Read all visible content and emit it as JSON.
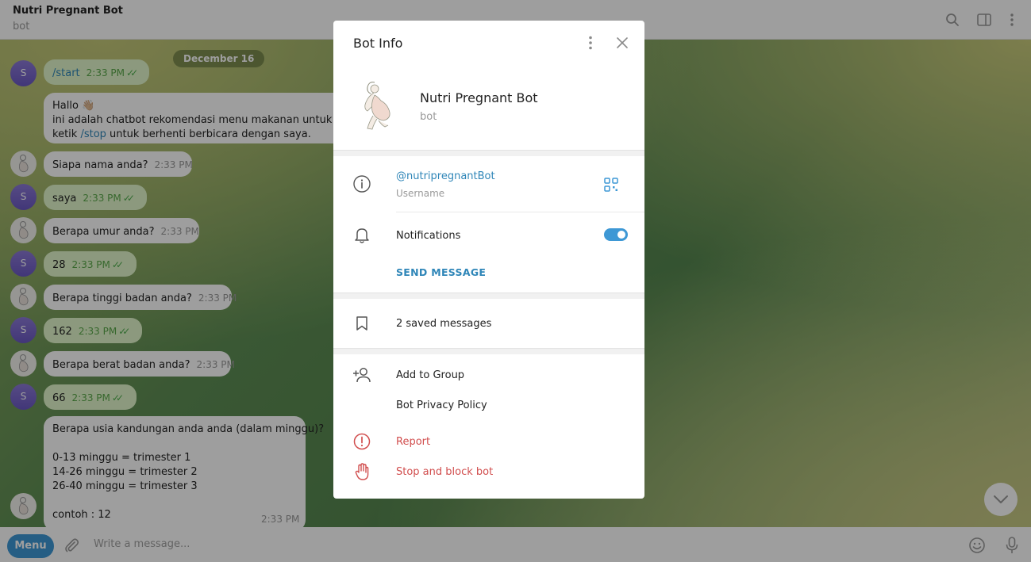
{
  "header": {
    "title": "Nutri Pregnant Bot",
    "subtitle": "bot",
    "icons": [
      "search-icon",
      "sidebar-icon",
      "more-vertical-icon"
    ]
  },
  "chat": {
    "date": "December 16",
    "user_initial": "S",
    "messages": [
      {
        "side": "out",
        "text": "/start",
        "time": "2:33 PM"
      },
      {
        "side": "in",
        "line1": "Hallo 👋🏼",
        "line2": "ini adalah chatbot rekomendasi menu makanan untuk ibu h",
        "line3_prefix": "ketik ",
        "line3_cmd": "/stop",
        "line3_suffix": " untuk berhenti berbicara dengan saya."
      },
      {
        "side": "in",
        "text": "Siapa nama anda?",
        "time": "2:33 PM"
      },
      {
        "side": "out",
        "text": "saya",
        "time": "2:33 PM"
      },
      {
        "side": "in",
        "text": "Berapa umur anda?",
        "time": "2:33 PM"
      },
      {
        "side": "out",
        "text": "28",
        "time": "2:33 PM"
      },
      {
        "side": "in",
        "text": "Berapa tinggi badan anda?",
        "time": "2:33 PM"
      },
      {
        "side": "out",
        "text": "162",
        "time": "2:33 PM"
      },
      {
        "side": "in",
        "text": "Berapa berat badan anda?",
        "time": "2:33 PM"
      },
      {
        "side": "out",
        "text": "66",
        "time": "2:33 PM"
      },
      {
        "side": "in",
        "text": "Berapa usia kandungan anda anda (dalam minggu)?\n\n0-13 minggu = trimester 1\n14-26 minggu = trimester 2\n26-40 minggu = trimester 3\n\ncontoh : 12",
        "time": "2:33 PM"
      }
    ]
  },
  "composer": {
    "menu_label": "Menu",
    "placeholder": "Write a message..."
  },
  "dialog": {
    "title": "Bot Info",
    "name": "Nutri Pregnant Bot",
    "status": "bot",
    "username": "@nutripregnantBot",
    "username_label": "Username",
    "notifications_label": "Notifications",
    "notifications_on": true,
    "send_message": "SEND MESSAGE",
    "saved_messages": "2 saved messages",
    "add_to_group": "Add to Group",
    "privacy_policy": "Bot Privacy Policy",
    "report": "Report",
    "stop_block": "Stop and block bot"
  },
  "colors": {
    "accent": "#3e98d5",
    "link": "#2f86b8",
    "danger": "#d14e4e",
    "outgoing_bubble": "#e2f7cb"
  }
}
